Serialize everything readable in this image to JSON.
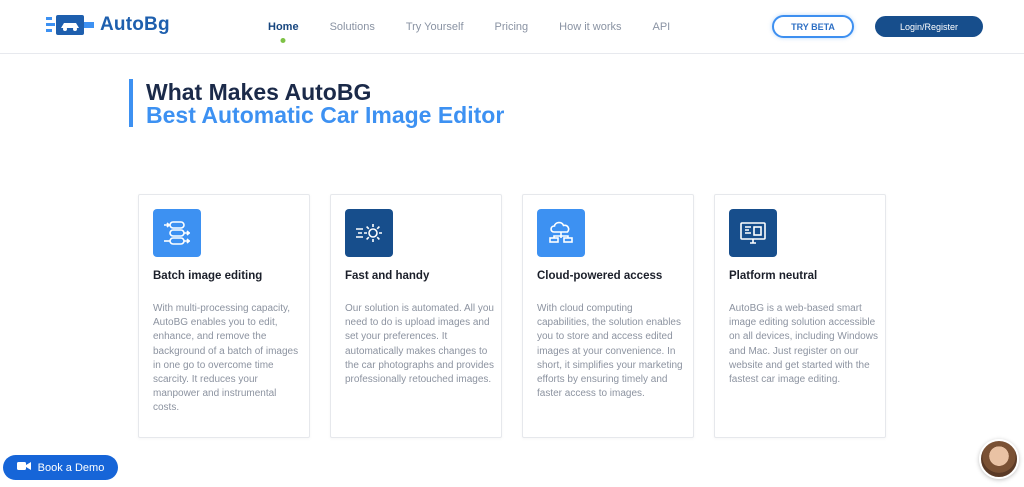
{
  "brand": {
    "name": "AutoBg",
    "accent": "#3d91f2",
    "dark": "#174e8c"
  },
  "nav": {
    "items": [
      {
        "label": "Home"
      },
      {
        "label": "Solutions"
      },
      {
        "label": "Try Yourself"
      },
      {
        "label": "Pricing"
      },
      {
        "label": "How it works"
      },
      {
        "label": "API"
      }
    ],
    "active": "Home"
  },
  "header": {
    "try_beta_label": "TRY BETA",
    "login_label": "Login/Register"
  },
  "section": {
    "title_line1": "What Makes AutoBG",
    "title_line2": "Best Automatic Car Image Editor"
  },
  "cards": [
    {
      "icon": "batch-flow-icon",
      "icon_color": "#3d91f2",
      "title": "Batch image editing",
      "body": "With multi-processing capacity, AutoBG enables you to edit, enhance, and remove the background of a batch of images in one go to overcome time scarcity. It reduces your manpower and instrumental costs."
    },
    {
      "icon": "fast-gear-icon",
      "icon_color": "#174e8c",
      "title": "Fast and handy",
      "body": "Our solution is automated. All you need to do is upload images and set your preferences. It automatically makes changes to the car photographs and provides professionally retouched images."
    },
    {
      "icon": "cloud-network-icon",
      "icon_color": "#3d91f2",
      "title": "Cloud-powered access",
      "body": "With cloud computing capabilities, the solution enables you to store and access edited images at your convenience. In short, it simplifies your marketing efforts by ensuring timely and faster access to images."
    },
    {
      "icon": "monitor-icon",
      "icon_color": "#174e8c",
      "title": "Platform neutral",
      "body": "AutoBG is a web-based smart image editing solution accessible on all devices, including Windows and Mac. Just register on our website and get started with the fastest car image editing."
    }
  ],
  "widgets": {
    "demo_label": "Book a Demo",
    "avatar": "support-agent-avatar"
  }
}
